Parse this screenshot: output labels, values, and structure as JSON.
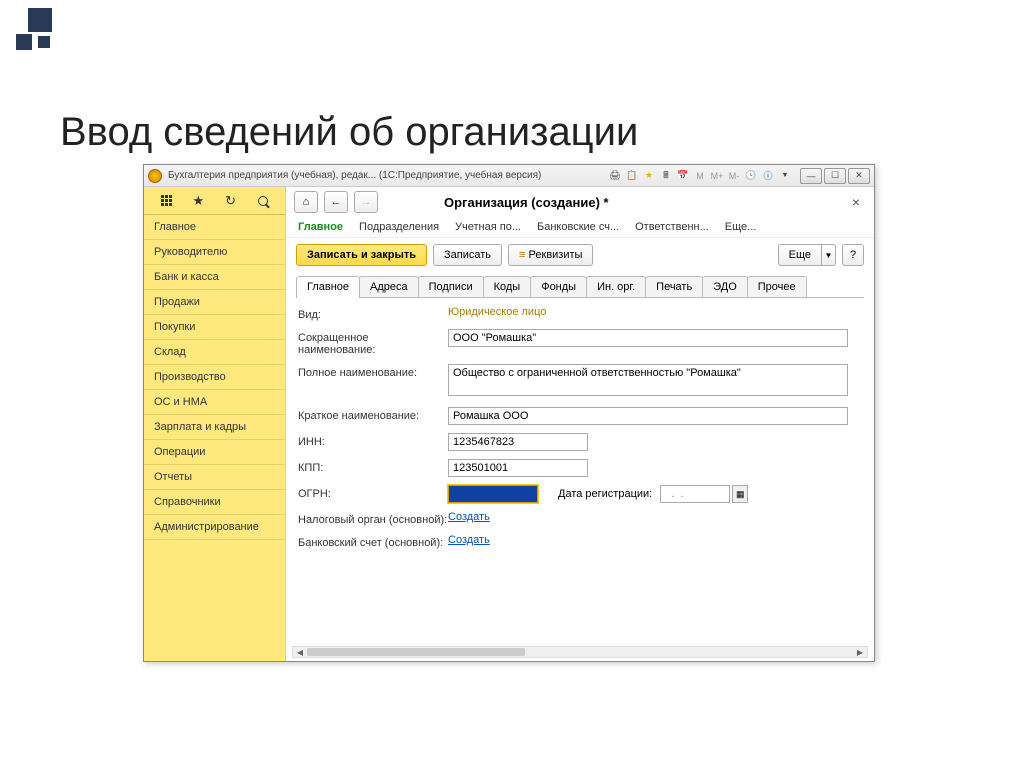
{
  "slide_title": "Ввод сведений об организации",
  "titlebar": {
    "text": "Бухгалтерия предприятия (учебная), редак... (1С:Предприятие, учебная версия)",
    "icons_text": [
      "M",
      "M+",
      "M-"
    ]
  },
  "sidebar": {
    "items": [
      "Главное",
      "Руководителю",
      "Банк и касса",
      "Продажи",
      "Покупки",
      "Склад",
      "Производство",
      "ОС и НМА",
      "Зарплата и кадры",
      "Операции",
      "Отчеты",
      "Справочники",
      "Администрирование"
    ]
  },
  "page_title": "Организация (создание) *",
  "section_tabs": [
    "Главное",
    "Подразделения",
    "Учетная по...",
    "Банковские сч...",
    "Ответственн...",
    "Еще..."
  ],
  "actions": {
    "save_close": "Записать и закрыть",
    "save": "Записать",
    "props": "Реквизиты",
    "more": "Еще",
    "help": "?"
  },
  "inner_tabs": [
    "Главное",
    "Адреса",
    "Подписи",
    "Коды",
    "Фонды",
    "Ин. орг.",
    "Печать",
    "ЭДО",
    "Прочее"
  ],
  "form": {
    "vid_label": "Вид:",
    "vid_value": "Юридическое лицо",
    "short_label": "Сокращенное наименование:",
    "short_value": "ООО \"Ромашка\"",
    "full_label": "Полное наименование:",
    "full_value": "Общество с ограниченной ответственностью \"Ромашка\"",
    "brief_label": "Краткое наименование:",
    "brief_value": "Ромашка ООО",
    "inn_label": "ИНН:",
    "inn_value": "1235467823",
    "kpp_label": "КПП:",
    "kpp_value": "123501001",
    "ogrn_label": "ОГРН:",
    "ogrn_value": "",
    "regdate_label": "Дата регистрации:",
    "regdate_value": "  .  .    ",
    "tax_label": "Налоговый орган (основной):",
    "tax_link": "Создать",
    "bank_label": "Банковский счет (основной):",
    "bank_link": "Создать"
  }
}
